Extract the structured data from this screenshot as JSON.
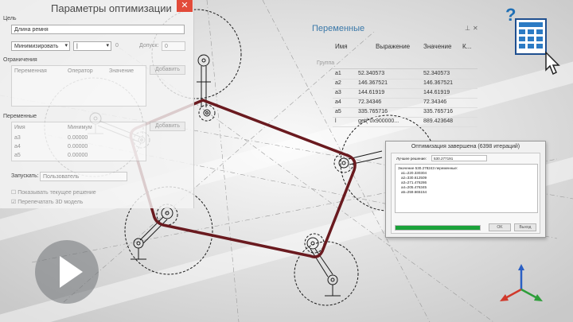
{
  "optimization_panel": {
    "title": "Параметры оптимизации",
    "close_glyph": "✕",
    "goal_label": "Цель",
    "goal_value": "Длина ремня",
    "mode_value": "Минимизировать",
    "operator_value": "|",
    "target_value": "0",
    "tolerance_label": "Допуск:",
    "tolerance_value": "0",
    "constraints_label": "Ограничения",
    "constraints_columns": [
      "Переменная",
      "Оператор",
      "Значение"
    ],
    "add_constraint_button": "Добавить",
    "variables_label": "Переменные",
    "variables_columns": [
      "Имя",
      "Минимум"
    ],
    "variables_rows": [
      {
        "name": "a3",
        "min": "0.00000"
      },
      {
        "name": "a4",
        "min": "0.00000"
      },
      {
        "name": "a5",
        "min": "0.00000"
      }
    ],
    "add_variable_button": "Добавить",
    "run_label": "Запускать:",
    "run_value": "Пользователь",
    "show_current_checkbox": "Показывать текущее решение",
    "recompute_checkbox": "Перепечатать 3D модель"
  },
  "variables_panel": {
    "title": "Переменные",
    "pin_glyph": "⊥",
    "close_glyph": "✕",
    "columns": [
      "Имя",
      "Выражение",
      "Значение",
      "К..."
    ],
    "group_label": "Группа",
    "rows": [
      {
        "name": "a1",
        "expr": "52.340573",
        "value": "52.340573"
      },
      {
        "name": "a2",
        "expr": "146.367521",
        "value": "146.367521"
      },
      {
        "name": "a3",
        "expr": "144.61919",
        "value": "144.61919"
      },
      {
        "name": "a4",
        "expr": "72.34346",
        "value": "72.34346"
      },
      {
        "name": "a5",
        "expr": "335.765716",
        "value": "335.765716"
      },
      {
        "name": "l",
        "expr": "get(\"0x900000...",
        "value": "889.423648"
      }
    ]
  },
  "completion_dialog": {
    "title": "Оптимизация завершена (6398 итераций)",
    "best_label": "Лучшее решение:",
    "best_value": "530.277191",
    "result_lines": [
      "Значение 530.278243 переменные:",
      "a1=220.330304",
      "a2=330.612509",
      "a3=271.476286",
      "a4=205.476345",
      "a5=259.665154"
    ],
    "progress": 1.0,
    "progress_color": "#1aa23a",
    "ok_button": "OK",
    "exit_button": "Выход"
  },
  "help_icon": {
    "glyph": "?",
    "color": "#1f6fb5"
  },
  "play_button": {
    "icon": "play-icon"
  },
  "axis_triad": {
    "x_color": "#d0392b",
    "y_color": "#2e9e3a",
    "z_color": "#2a5fc4"
  },
  "belt_color": "#6a1a1f"
}
